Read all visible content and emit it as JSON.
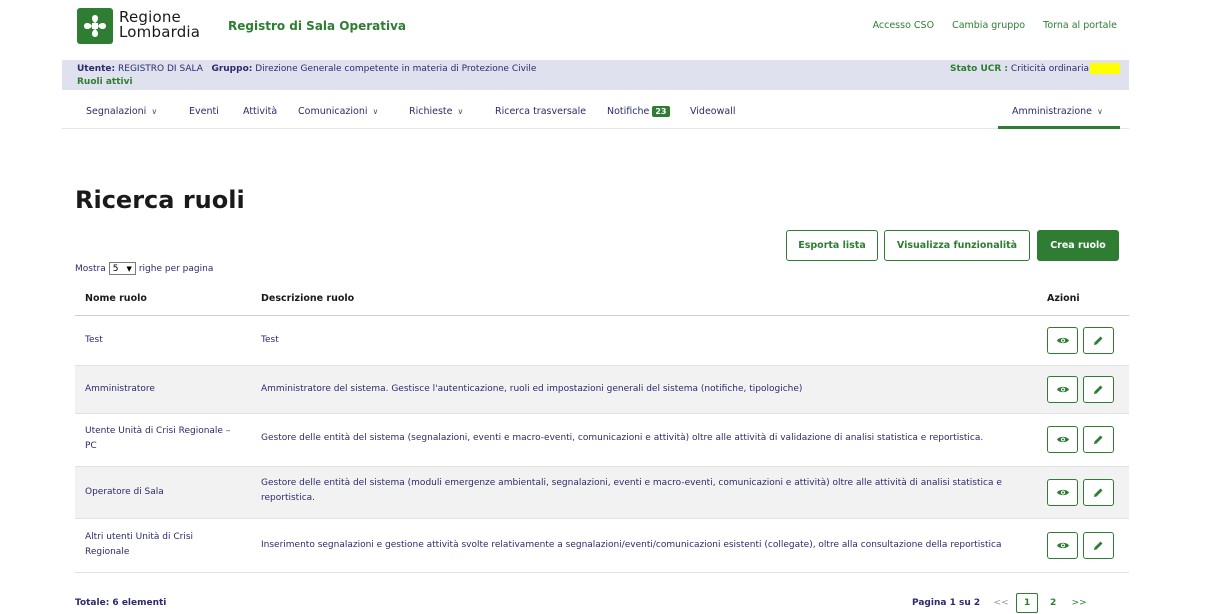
{
  "header": {
    "brand_line1": "Regione",
    "brand_line2": "Lombardia",
    "app_title": "Registro di Sala Operativa",
    "links": [
      "Accesso CSO",
      "Cambia gruppo",
      "Torna al portale"
    ]
  },
  "userbar": {
    "utente_label": "Utente:",
    "utente_value": "REGISTRO DI SALA",
    "gruppo_label": "Gruppo:",
    "gruppo_value": "Direzione Generale competente in materia di Protezione Civile",
    "ruoli_attivi": "Ruoli attivi",
    "stato_label": "Stato UCR :",
    "stato_value": "Criticità ordinaria",
    "stato_color": "#ffff00"
  },
  "nav": {
    "items": [
      {
        "label": "Segnalazioni",
        "dropdown": true
      },
      {
        "label": "Eventi"
      },
      {
        "label": "Attività"
      },
      {
        "label": "Comunicazioni",
        "dropdown": true
      },
      {
        "label": "Richieste",
        "dropdown": true
      },
      {
        "label": "Ricerca trasversale"
      },
      {
        "label": "Notifiche",
        "badge": "23"
      },
      {
        "label": "Videowall"
      }
    ],
    "active": {
      "label": "Amministrazione",
      "dropdown": true
    }
  },
  "page": {
    "title": "Ricerca ruoli"
  },
  "toolbar": {
    "export_label": "Esporta lista",
    "view_functions_label": "Visualizza funzionalità",
    "create_label": "Crea ruolo"
  },
  "pagesize": {
    "prefix": "Mostra",
    "value": "5",
    "suffix": "righe per pagina"
  },
  "table": {
    "columns": [
      "Nome ruolo",
      "Descrizione ruolo",
      "Azioni"
    ],
    "rows": [
      {
        "name": "Test",
        "description": "Test"
      },
      {
        "name": "Amministratore",
        "description": "Amministratore del sistema. Gestisce l'autenticazione, ruoli ed impostazioni generali del sistema (notifiche, tipologiche)"
      },
      {
        "name": "Utente Unità di Crisi Regionale – PC",
        "description": "Gestore delle entità del sistema (segnalazioni, eventi e macro-eventi, comunicazioni e attività) oltre alle attività di validazione di analisi statistica e reportistica."
      },
      {
        "name": "Operatore di Sala",
        "description": "Gestore delle entità del sistema (moduli emergenze ambientali, segnalazioni, eventi e macro-eventi, comunicazioni e attività) oltre alle attività di analisi statistica e reportistica."
      },
      {
        "name": "Altri utenti Unità di Crisi Regionale",
        "description": "Inserimento segnalazioni e gestione attività svolte relativamente a segnalazioni/eventi/comunicazioni esistenti (collegate), oltre alla consultazione della reportistica"
      }
    ]
  },
  "footer": {
    "totale": "Totale: 6 elementi",
    "page_info": "Pagina 1 su 2",
    "prev": "<<",
    "pages": [
      "1",
      "2"
    ],
    "next": ">>"
  },
  "colors": {
    "accent": "#2e7d32",
    "text_blue": "#2b2b6e",
    "userbar_bg": "#dfe2ee"
  }
}
